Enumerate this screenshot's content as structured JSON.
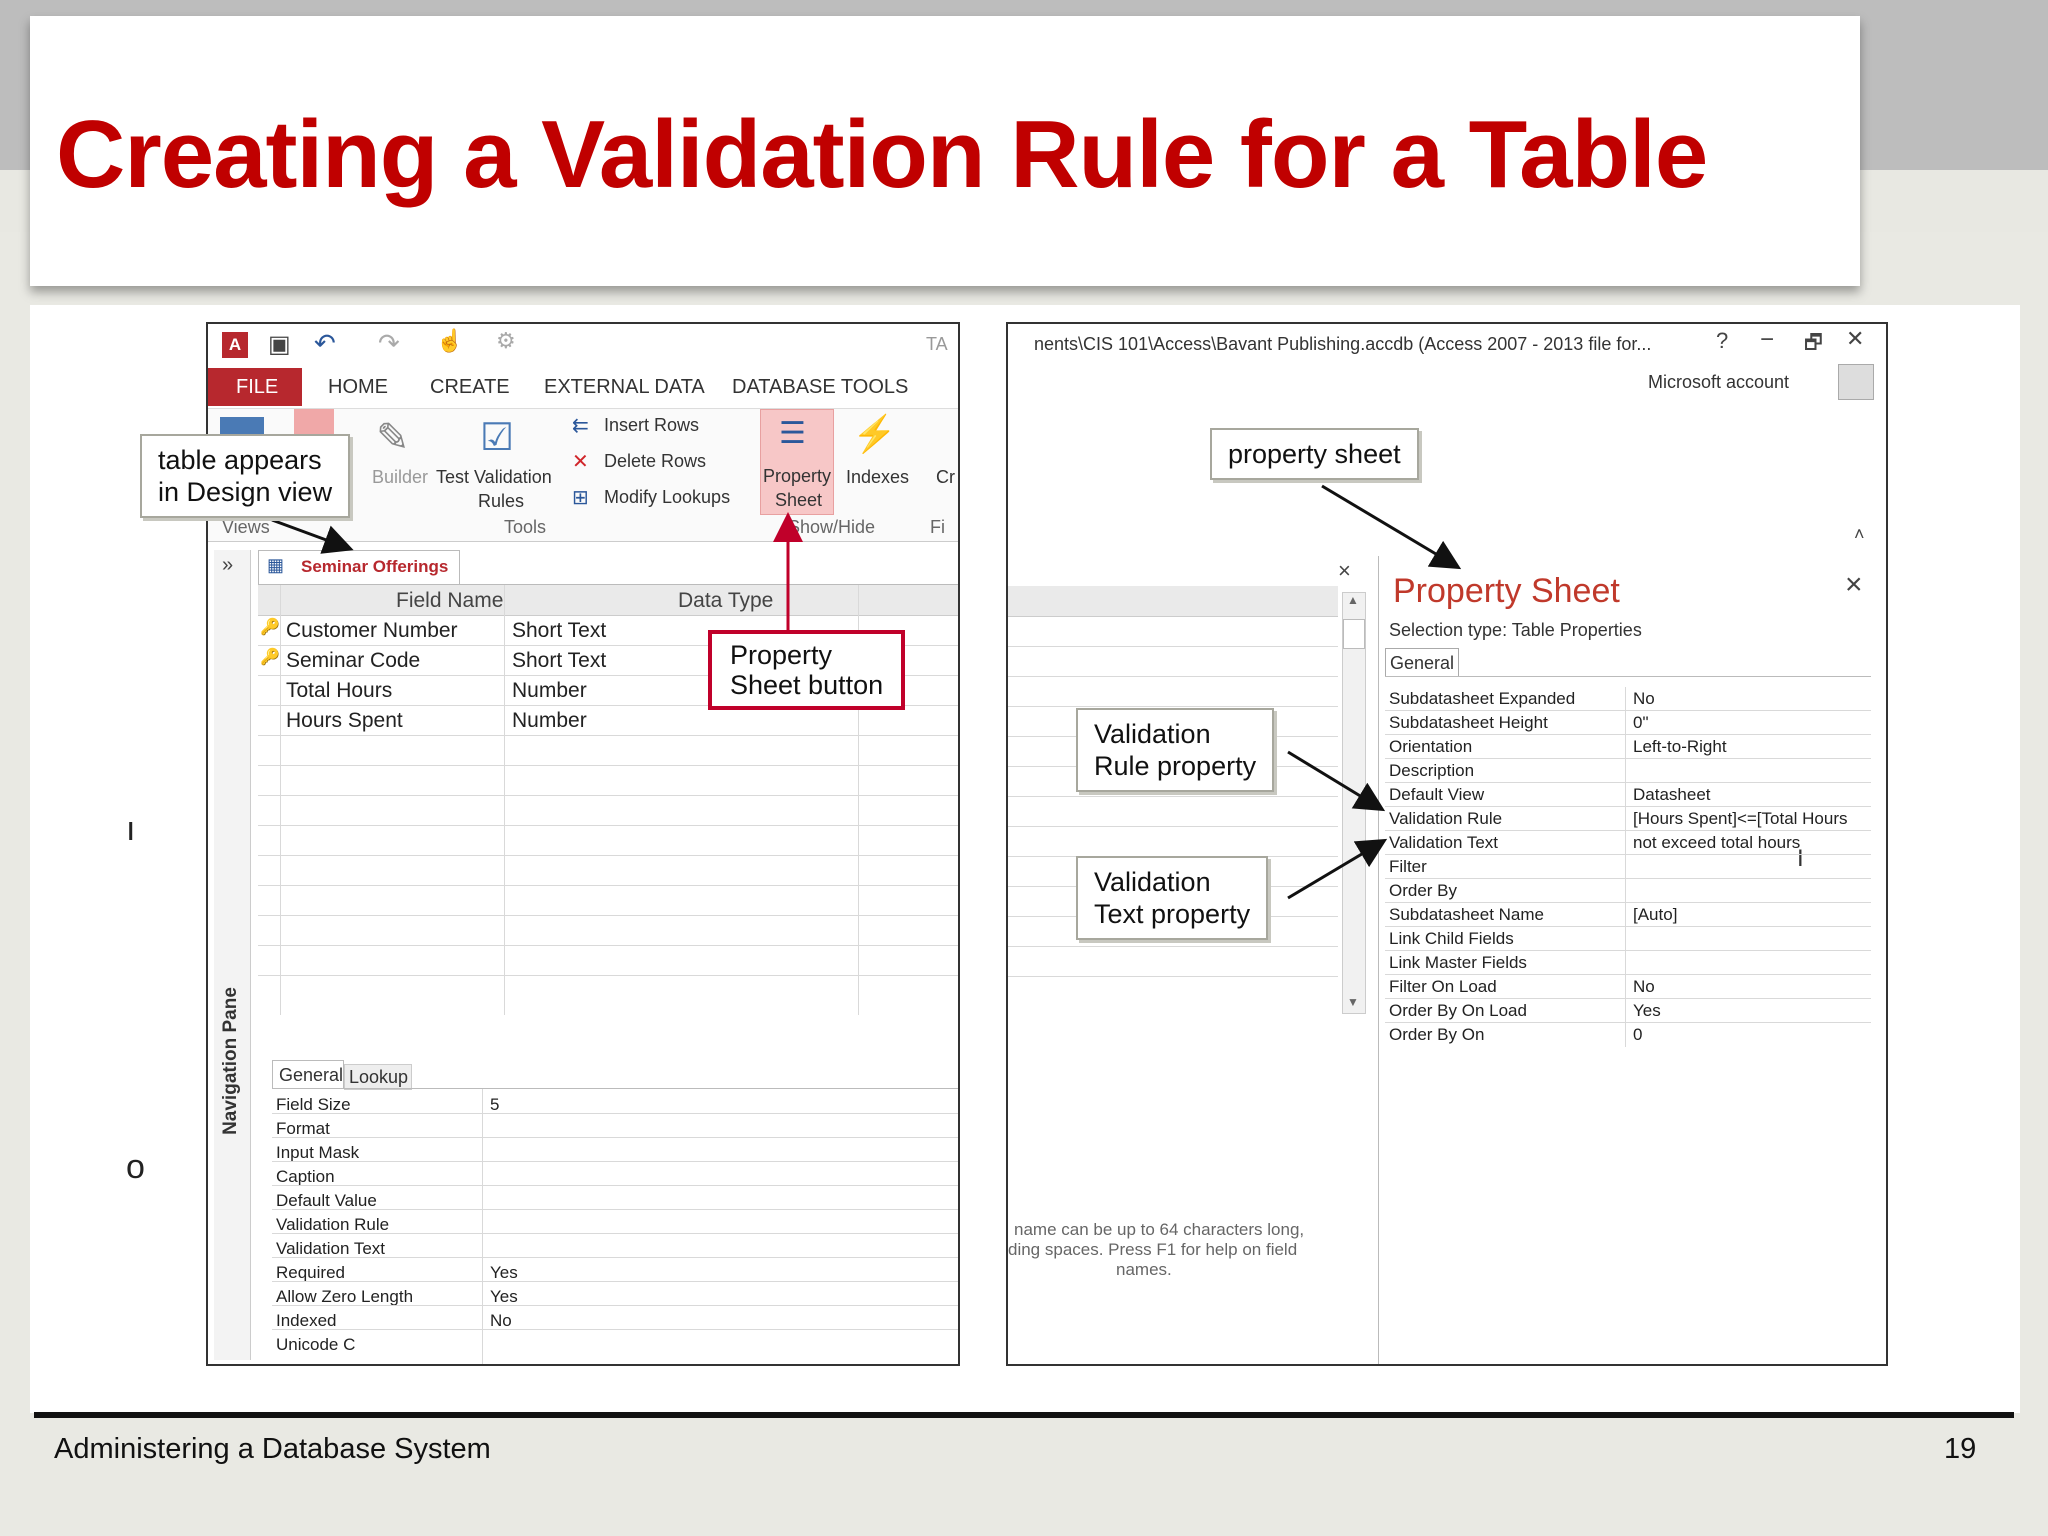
{
  "slide": {
    "title": "Creating a Validation Rule for a Table",
    "footer": "Administering a Database System",
    "page_number": "19",
    "side_glyphs": [
      "ı",
      "o"
    ]
  },
  "left_screenshot": {
    "qat_icons": [
      "access-logo-icon",
      "save-icon",
      "undo-icon",
      "redo-icon",
      "touch-icon",
      "customize-icon"
    ],
    "tabs": [
      "FILE",
      "HOME",
      "CREATE",
      "EXTERNAL DATA",
      "DATABASE TOOLS"
    ],
    "tools_group": {
      "builder": "Builder",
      "test_validation": "Test Validation",
      "rules": "Rules",
      "insert_rows": "Insert Rows",
      "delete_rows": "Delete Rows",
      "modify_lookups": "Modify Lookups",
      "label": "Tools"
    },
    "views_label": "Views",
    "show_hide": {
      "property": "Property",
      "sheet": "Sheet",
      "indexes": "Indexes",
      "label": "Show/Hide",
      "partial_c": "Cr",
      "partial_fi": "Fi",
      "partial_ta": "TA"
    },
    "nav_pane": "Navigation Pane",
    "nav_chevron": "»",
    "document_tab": "Seminar Offerings",
    "close_x": "×",
    "columns": [
      "Field Name",
      "Data Type"
    ],
    "fields": [
      {
        "name": "Customer Number",
        "type": "Short Text"
      },
      {
        "name": "Seminar Code",
        "type": "Short Text"
      },
      {
        "name": "Total Hours",
        "type": "Number"
      },
      {
        "name": "Hours Spent",
        "type": "Number"
      }
    ],
    "bottom_tabs": [
      "General",
      "Lookup"
    ],
    "field_props": [
      {
        "label": "Field Size",
        "value": "5"
      },
      {
        "label": "Format",
        "value": ""
      },
      {
        "label": "Input Mask",
        "value": ""
      },
      {
        "label": "Caption",
        "value": ""
      },
      {
        "label": "Default Value",
        "value": ""
      },
      {
        "label": "Validation Rule",
        "value": ""
      },
      {
        "label": "Validation Text",
        "value": ""
      },
      {
        "label": "Required",
        "value": "Yes"
      },
      {
        "label": "Allow Zero Length",
        "value": "Yes"
      },
      {
        "label": "Indexed",
        "value": "No"
      },
      {
        "label": "Unicode C",
        "value": ""
      }
    ]
  },
  "right_screenshot": {
    "title_bar": "nents\\CIS 101\\Access\\Bavant Publishing.accdb (Access 2007 - 2013 file for...",
    "help": "?",
    "minimize": "−",
    "restore": "🗗",
    "close": "✕",
    "account": "Microsoft account",
    "property_sheet_title": "Property Sheet",
    "selection_type": "Selection type:  Table Properties",
    "general_tab": "General",
    "sheet_close": "×",
    "hint_lines": [
      "name can be up to 64 characters long,",
      "ding spaces. Press F1 for help on field",
      "names."
    ],
    "properties": [
      {
        "label": "Subdatasheet Expanded",
        "value": "No"
      },
      {
        "label": "Subdatasheet Height",
        "value": "0\""
      },
      {
        "label": "Orientation",
        "value": "Left-to-Right"
      },
      {
        "label": "Description",
        "value": ""
      },
      {
        "label": "Default View",
        "value": "Datasheet"
      },
      {
        "label": "Validation Rule",
        "value": "[Hours Spent]<=[Total Hours"
      },
      {
        "label": "Validation Text",
        "value": "not exceed total hours"
      },
      {
        "label": "Filter",
        "value": ""
      },
      {
        "label": "Order By",
        "value": ""
      },
      {
        "label": "Subdatasheet Name",
        "value": "[Auto]"
      },
      {
        "label": "Link Child Fields",
        "value": ""
      },
      {
        "label": "Link Master Fields",
        "value": ""
      },
      {
        "label": "Filter On Load",
        "value": "No"
      },
      {
        "label": "Order By On Load",
        "value": "Yes"
      },
      {
        "label": "Order By On",
        "value": "0"
      }
    ]
  },
  "callouts": {
    "design_view": [
      "table appears",
      "in Design view"
    ],
    "property_sheet_button": [
      "Property",
      "Sheet button"
    ],
    "property_sheet": "property sheet",
    "validation_rule": [
      "Validation",
      "Rule property"
    ],
    "validation_text": [
      "Validation",
      "Text property"
    ]
  },
  "colors": {
    "title": "#c00000",
    "file_tab": "#b7282e",
    "callout_red": "#c0002a",
    "property_sheet_title": "#c0392b"
  }
}
